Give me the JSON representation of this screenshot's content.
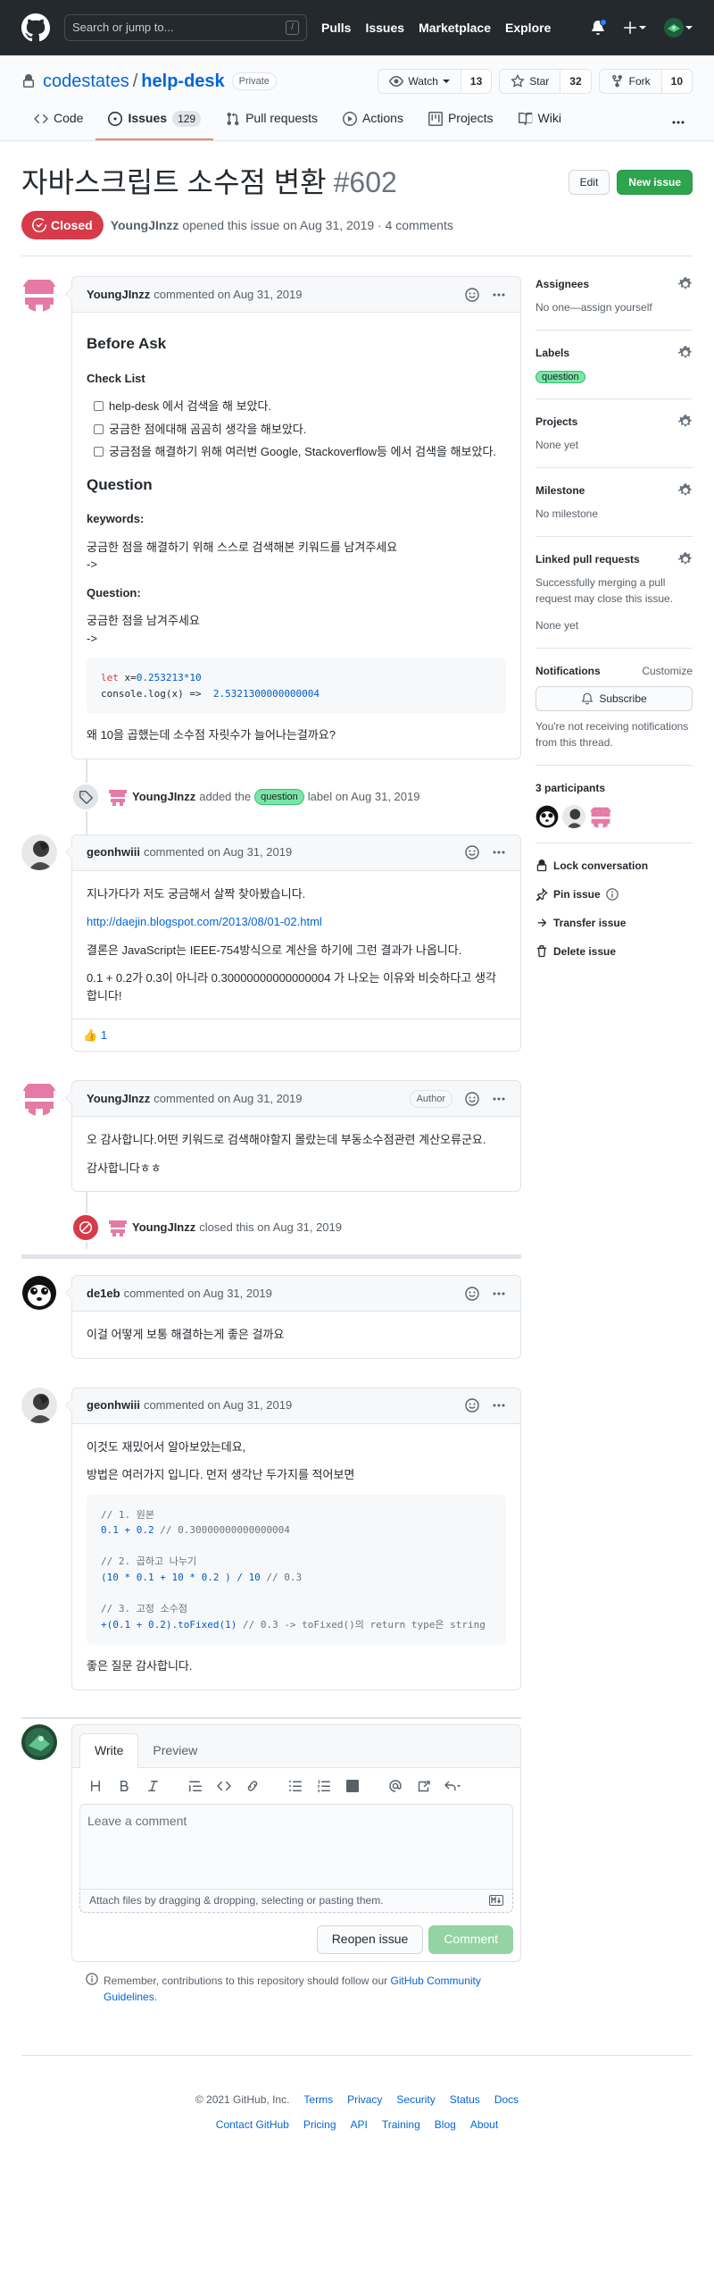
{
  "header": {
    "search_placeholder": "Search or jump to...",
    "slash_key": "/",
    "nav": [
      "Pulls",
      "Issues",
      "Marketplace",
      "Explore"
    ]
  },
  "repo": {
    "owner": "codestates",
    "separator": "/",
    "name": "help-desk",
    "visibility": "Private",
    "watch_label": "Watch",
    "watch_count": "13",
    "star_label": "Star",
    "star_count": "32",
    "fork_label": "Fork",
    "fork_count": "10"
  },
  "tabs": [
    {
      "label": "Code",
      "icon": "code-icon"
    },
    {
      "label": "Issues",
      "icon": "issue-opened-icon",
      "count": "129"
    },
    {
      "label": "Pull requests",
      "icon": "git-pull-request-icon"
    },
    {
      "label": "Actions",
      "icon": "play-icon"
    },
    {
      "label": "Projects",
      "icon": "project-icon"
    },
    {
      "label": "Wiki",
      "icon": "book-icon"
    }
  ],
  "issue": {
    "title": "자바스크립트 소수점 변환",
    "number": "#602",
    "edit_label": "Edit",
    "new_issue_label": "New issue",
    "state": "Closed",
    "author": "YoungJInzz",
    "meta": "opened this issue on Aug 31, 2019 · 4 comments"
  },
  "comments": {
    "c1": {
      "author": "YoungJInzz",
      "meta": "commented on Aug 31, 2019",
      "h_before": "Before Ask",
      "h_checklist": "Check List",
      "tasks": [
        "help-desk 에서 검색을 해 보았다.",
        "궁금한 점에대해 곰곰히 생각을 해보았다.",
        "궁금점을 해결하기 위해 여러번 Google, Stackoverflow등 에서 검색을 해보았다."
      ],
      "h_question": "Question",
      "h_keywords": "keywords:",
      "keywords_text": "궁금한 점을 해결하기 위해 스스로 검색해본 키워드를 남겨주세요",
      "arrow1": "->",
      "h_question2": "Question:",
      "question_text": "궁금한 점을 남겨주세요",
      "arrow2": "->",
      "code_kw": "let",
      "code_var": " x=",
      "code_num": "0.253213*10",
      "code_line2a": "console.",
      "code_fn": "log",
      "code_line2b": "(x) =>  ",
      "code_result": "2.5321300000000004",
      "closing": "왜 10을 곱했는데 소수점 자릿수가 늘어나는걸까요?"
    },
    "e1": {
      "actor": "YoungJInzz",
      "pre": "added the",
      "label": "question",
      "post": "label on Aug 31, 2019"
    },
    "c2": {
      "author": "geonhwiii",
      "meta": "commented on Aug 31, 2019",
      "p1": "지나가다가 저도 궁금해서 살짝 찾아봤습니다.",
      "link": "http://daejin.blogspot.com/2013/08/01-02.html",
      "p2": "결론은 JavaScript는 IEEE-754방식으로 계산을 하기에 그런 결과가 나옵니다.",
      "p3": "0.1 + 0.2가 0.3이 아니라 0.30000000000000004 가 나오는 이유와 비슷하다고 생각합니다!",
      "reaction_emoji": "👍",
      "reaction_count": "1"
    },
    "c3": {
      "author": "YoungJInzz",
      "meta": "commented on Aug 31, 2019",
      "badge": "Author",
      "p1": "오 감사합니다.어떤 키워드로 검색해야할지 몰랐는데 부동소수점관련 계산오류군요.",
      "p2": "감사합니다ㅎㅎ"
    },
    "e2": {
      "actor": "YoungJInzz",
      "text": "closed this on Aug 31, 2019"
    },
    "c4": {
      "author": "de1eb",
      "meta": "commented on Aug 31, 2019",
      "p1": "이걸 어떻게 보통 해결하는게 좋은 걸까요"
    },
    "c5": {
      "author": "geonhwiii",
      "meta": "commented on Aug 31, 2019",
      "p1": "이것도 재밌어서 알아보았는데요,",
      "p2": "방법은 여러가지 입니다. 먼저 생각난 두가지를 적어보면",
      "code1_cm": "// 1. 원본",
      "code1_a": "0.1 + 0.2",
      "code1_b": " // 0.30000000000000004",
      "code2_cm": "// 2. 곱하고 나누기",
      "code2_a": "(10 * 0.1 + 10 * 0.2 ) / 10",
      "code2_b": " // 0.3",
      "code3_cm": "// 3. 고정 소수점",
      "code3_a": "+(0.1 + 0.2).",
      "code3_fn": "toFixed",
      "code3_b": "(1)",
      "code3_c": " // 0.3 -> toFixed()의 return type은 string",
      "p3": "좋은 질문 감사합니다."
    }
  },
  "editor": {
    "write_tab": "Write",
    "preview_tab": "Preview",
    "placeholder": "Leave a comment",
    "attach_text": "Attach files by dragging & dropping, selecting or pasting them.",
    "reopen_label": "Reopen issue",
    "comment_label": "Comment",
    "tip_pre": "Remember, contributions to this repository should follow our",
    "tip_link": "GitHub Community Guidelines",
    "tip_post": "."
  },
  "sidebar": {
    "assignees_title": "Assignees",
    "assignees_value": "No one—assign yourself",
    "labels_title": "Labels",
    "labels_value": "question",
    "projects_title": "Projects",
    "projects_value": "None yet",
    "milestone_title": "Milestone",
    "milestone_value": "No milestone",
    "linked_title": "Linked pull requests",
    "linked_text": "Successfully merging a pull request may close this issue.",
    "linked_value": "None yet",
    "notifications_title": "Notifications",
    "customize": "Customize",
    "subscribe": "Subscribe",
    "notif_text": "You're not receiving notifications from this thread.",
    "participants": "3 participants",
    "lock": "Lock conversation",
    "pin": "Pin issue",
    "transfer": "Transfer issue",
    "delete": "Delete issue"
  },
  "footer": {
    "copyright": "© 2021 GitHub, Inc.",
    "row1": [
      "Terms",
      "Privacy",
      "Security",
      "Status",
      "Docs"
    ],
    "row2": [
      "Contact GitHub",
      "Pricing",
      "API",
      "Training",
      "Blog",
      "About"
    ]
  },
  "colors": {
    "header_bg": "#24292e",
    "link": "#0366d6",
    "closed_red": "#d73a49",
    "green": "#2ea44f",
    "label_question": "#7ae6a6",
    "identicon_pink": "#e57aa6"
  }
}
